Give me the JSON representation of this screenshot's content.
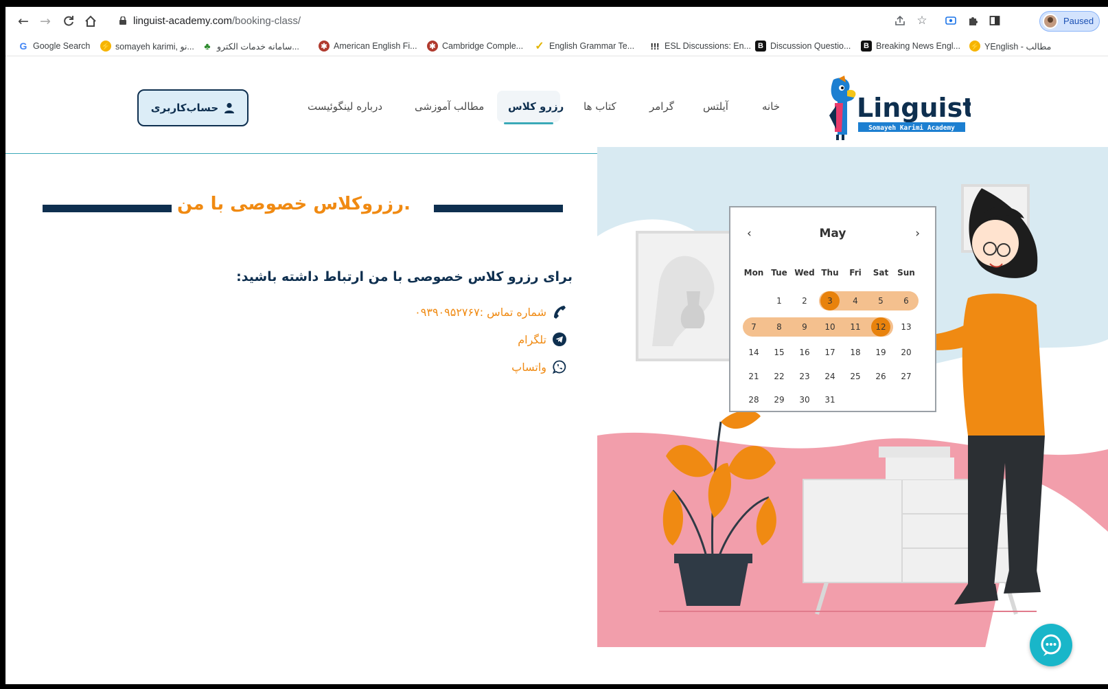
{
  "browser": {
    "url_host": "linguist-academy.com",
    "url_path": "/booking-class/",
    "profile_label": "Paused",
    "bookmarks": [
      {
        "label": "Google Search"
      },
      {
        "label": "somayeh karimi, نو..."
      },
      {
        "label": "سامانه خدمات الكترو..."
      },
      {
        "label": "American English Fi..."
      },
      {
        "label": "Cambridge Comple..."
      },
      {
        "label": "English Grammar Te..."
      },
      {
        "label": "ESL Discussions: En..."
      },
      {
        "label": "Discussion Questio..."
      },
      {
        "label": "Breaking News Engl..."
      },
      {
        "label": "YEnglish - مطالب"
      }
    ]
  },
  "header": {
    "logo_text": "Linguist",
    "logo_subtitle": "Somayeh Karimi Academy",
    "account_button": "حساب‌کاربری",
    "menu": [
      {
        "label": "خانه",
        "active": false
      },
      {
        "label": "آیلتس",
        "active": false
      },
      {
        "label": "گرامر",
        "active": false
      },
      {
        "label": "کتاب ها",
        "active": false
      },
      {
        "label": "رزرو کلاس",
        "active": true
      },
      {
        "label": "مطالب آموزشی",
        "active": false
      },
      {
        "label": "درباره لینگوئیست",
        "active": false
      }
    ]
  },
  "main": {
    "title": ".رزروکلاس خصوصی با من",
    "intro": "برای رزرو کلاس خصوصی با من ارتباط داشته باشید:",
    "contacts": [
      {
        "icon": "phone-icon",
        "label": "شماره تماس :۰۹۳۹۰۹۵۲۷۶۷"
      },
      {
        "icon": "telegram-icon",
        "label": "تلگرام"
      },
      {
        "icon": "whatsapp-icon",
        "label": "واتساپ"
      }
    ]
  },
  "calendar": {
    "month": "May",
    "weekdays": [
      "Mon",
      "Tue",
      "Wed",
      "Thu",
      "Fri",
      "Sat",
      "Sun"
    ],
    "weeks": [
      [
        "",
        "1",
        "2",
        "3",
        "4",
        "5",
        "6"
      ],
      [
        "7",
        "8",
        "9",
        "10",
        "11",
        "12",
        "13"
      ],
      [
        "14",
        "15",
        "16",
        "17",
        "18",
        "19",
        "20"
      ],
      [
        "21",
        "22",
        "23",
        "24",
        "25",
        "26",
        "27"
      ],
      [
        "28",
        "29",
        "30",
        "31",
        "",
        "",
        ""
      ]
    ],
    "range_start": "3",
    "range_end": "12"
  },
  "colors": {
    "brand_navy": "#0e2f4f",
    "brand_orange": "#f08a12",
    "accent_teal": "#3aa9b8",
    "chat_button": "#19b6c9"
  }
}
